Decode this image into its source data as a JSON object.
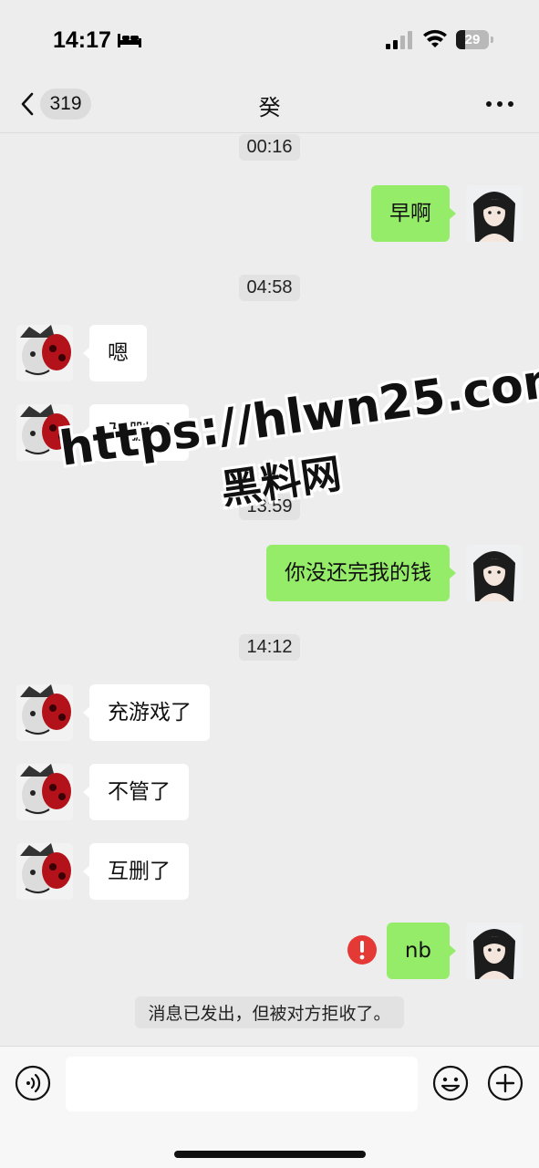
{
  "status_bar": {
    "time": "14:17",
    "battery_level": "29",
    "battery_fraction": 0.29,
    "icons": [
      "bed-icon",
      "signal-icon",
      "wifi-icon",
      "battery-icon"
    ]
  },
  "nav": {
    "unread_count": "319",
    "title": "癸",
    "icons": [
      "chevron-left-icon",
      "more-icon"
    ]
  },
  "messages": [
    {
      "kind": "time",
      "text": "00:16"
    },
    {
      "kind": "out",
      "text": "早啊"
    },
    {
      "kind": "time",
      "text": "04:58"
    },
    {
      "kind": "in",
      "text": "嗯"
    },
    {
      "kind": "in",
      "text": "互删吧"
    },
    {
      "kind": "time",
      "text": "13:59"
    },
    {
      "kind": "out",
      "text": "你没还完我的钱"
    },
    {
      "kind": "time",
      "text": "14:12"
    },
    {
      "kind": "in",
      "text": "充游戏了"
    },
    {
      "kind": "in",
      "text": "不管了"
    },
    {
      "kind": "in",
      "text": "互删了"
    },
    {
      "kind": "out",
      "text": "nb",
      "failed": true
    },
    {
      "kind": "system",
      "text": "消息已发出，但被对方拒收了。"
    }
  ],
  "watermark": {
    "url": "https://hlwn25.com",
    "name": "黑料网"
  },
  "input_bar": {
    "placeholder": "",
    "icons": [
      "voice-icon",
      "emoji-icon",
      "plus-icon"
    ]
  },
  "colors": {
    "background": "#ededed",
    "outgoing_bubble": "#95ec69",
    "incoming_bubble": "#ffffff",
    "error_badge": "#e53935"
  }
}
